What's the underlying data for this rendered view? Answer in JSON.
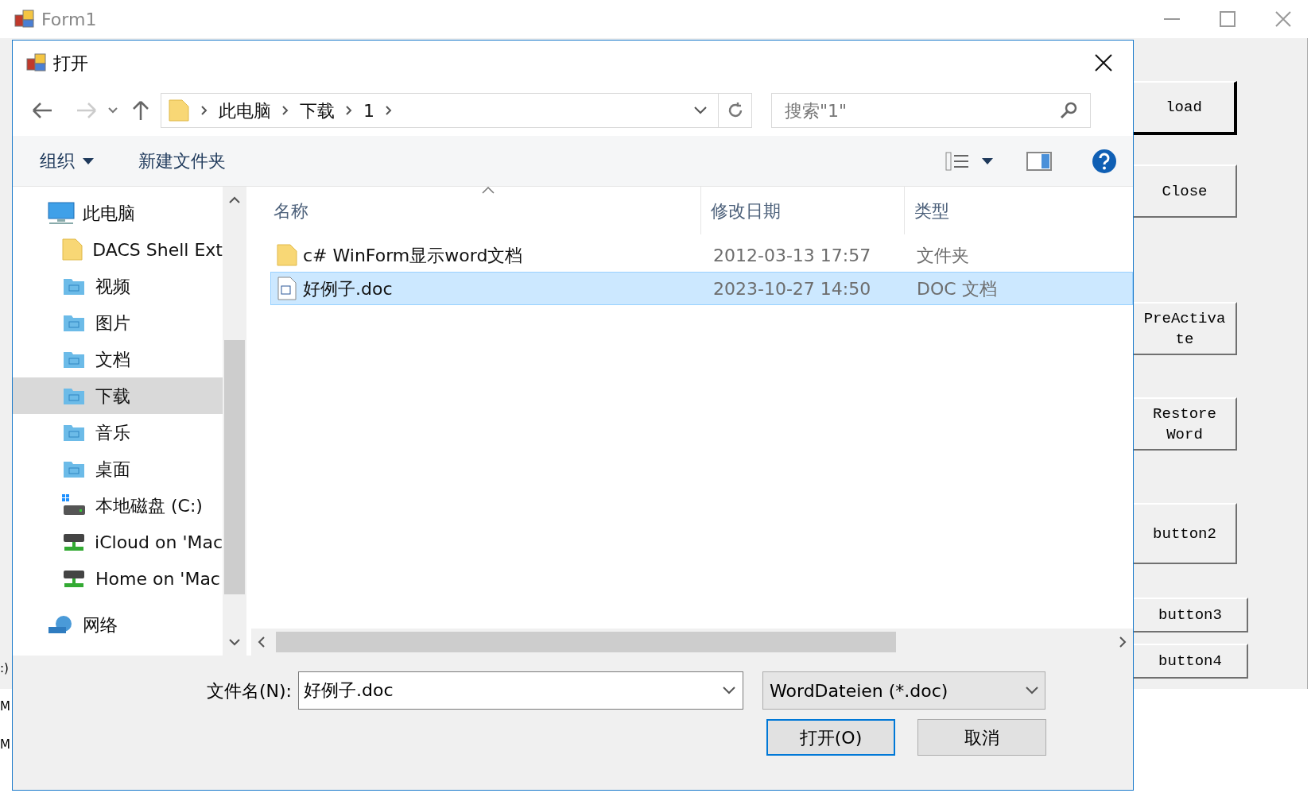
{
  "form": {
    "title": "Form1",
    "buttons": [
      {
        "label": "load",
        "default": true
      },
      {
        "label": "Close",
        "default": false
      },
      {
        "label": "PreActivate",
        "default": false
      },
      {
        "label": "Restore Word",
        "default": false
      },
      {
        "label": "button2",
        "default": false
      },
      {
        "label": "button3",
        "default": false
      },
      {
        "label": "button4",
        "default": false
      }
    ],
    "fragments": [
      ":)",
      "M",
      "M"
    ]
  },
  "dialog": {
    "title": "打开",
    "breadcrumb": [
      "此电脑",
      "下载",
      "1"
    ],
    "search": {
      "placeholder": "搜索\"1\""
    },
    "toolbar": {
      "organize": "组织",
      "new_folder": "新建文件夹"
    },
    "nav": [
      {
        "label": "此电脑",
        "kind": "computer",
        "selected": false,
        "children": [
          {
            "label": "DACS Shell Ext",
            "kind": "folder",
            "selected": false
          },
          {
            "label": "视频",
            "kind": "library",
            "selected": false
          },
          {
            "label": "图片",
            "kind": "library",
            "selected": false
          },
          {
            "label": "文档",
            "kind": "library",
            "selected": false
          },
          {
            "label": "下载",
            "kind": "library",
            "selected": true
          },
          {
            "label": "音乐",
            "kind": "library",
            "selected": false
          },
          {
            "label": "桌面",
            "kind": "library",
            "selected": false
          },
          {
            "label": "本地磁盘 (C:)",
            "kind": "drive",
            "selected": false
          },
          {
            "label": "iCloud on 'Mac",
            "kind": "netdrive",
            "selected": false
          },
          {
            "label": "Home on 'Mac",
            "kind": "netdrive",
            "selected": false
          }
        ]
      },
      {
        "label": "网络",
        "kind": "network",
        "selected": false
      }
    ],
    "columns": [
      "名称",
      "修改日期",
      "类型"
    ],
    "files": [
      {
        "name": "c# WinForm显示word文档",
        "date": "2012-03-13 17:57",
        "type": "文件夹",
        "kind": "folder",
        "selected": false
      },
      {
        "name": "好例子.doc",
        "date": "2023-10-27 14:50",
        "type": "DOC 文档",
        "kind": "doc",
        "selected": true
      }
    ],
    "filename_label": "文件名(N):",
    "filename": "好例子.doc",
    "filter": "WordDateien (*.doc)",
    "open_button": "打开(O)",
    "cancel_button": "取消"
  }
}
